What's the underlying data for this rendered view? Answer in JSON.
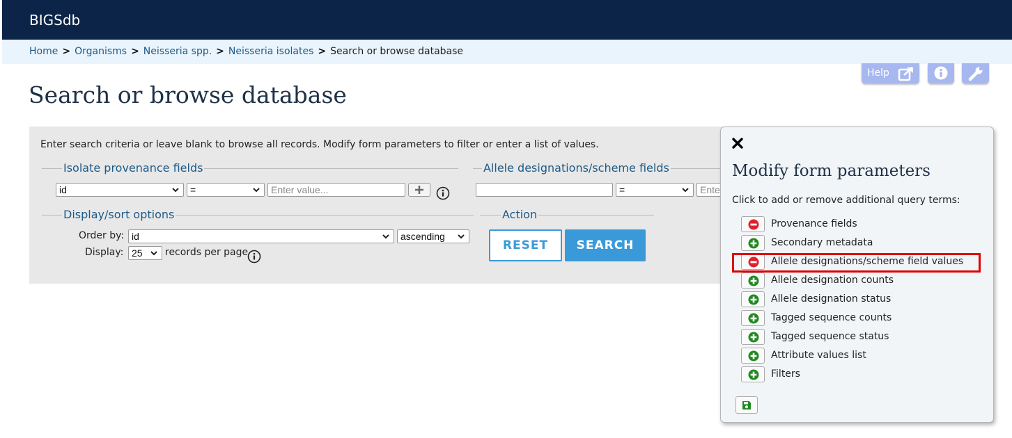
{
  "brand": "BIGSdb",
  "breadcrumb": {
    "items": [
      "Home",
      "Organisms",
      "Neisseria spp.",
      "Neisseria isolates"
    ],
    "current": "Search or browse database",
    "separator": ">"
  },
  "toolbar": {
    "help_label": "Help"
  },
  "page_title": "Search or browse database",
  "search_panel": {
    "instructions": "Enter search criteria or leave blank to browse all records. Modify form parameters to filter or enter a list of values.",
    "provenance": {
      "legend": "Isolate provenance fields",
      "field": "id",
      "operator": "=",
      "value_placeholder": "Enter value..."
    },
    "allele": {
      "legend": "Allele designations/scheme fields",
      "field": "",
      "operator": "=",
      "value_placeholder": "Ente"
    },
    "display_sort": {
      "legend": "Display/sort options",
      "order_by_label": "Order by:",
      "order_by": "id",
      "direction": "ascending",
      "display_label": "Display:",
      "per_page": "25",
      "records_per_page_label": "records per page"
    },
    "action": {
      "legend": "Action",
      "reset_label": "RESET",
      "search_label": "SEARCH"
    }
  },
  "modify_form": {
    "title": "Modify form parameters",
    "instructions": "Click to add or remove additional query terms:",
    "options": [
      {
        "label": "Provenance fields",
        "state": "remove"
      },
      {
        "label": "Secondary metadata",
        "state": "add"
      },
      {
        "label": "Allele designations/scheme field values",
        "state": "remove"
      },
      {
        "label": "Allele designation counts",
        "state": "add"
      },
      {
        "label": "Allele designation status",
        "state": "add"
      },
      {
        "label": "Tagged sequence counts",
        "state": "add"
      },
      {
        "label": "Tagged sequence status",
        "state": "add"
      },
      {
        "label": "Attribute values list",
        "state": "add"
      },
      {
        "label": "Filters",
        "state": "add"
      }
    ]
  },
  "icons": {
    "remove": "minus-circle-icon",
    "add": "plus-circle-icon",
    "save": "save-icon",
    "close": "close-icon"
  },
  "colors": {
    "header_bg": "#0b2447",
    "breadcrumb_bg": "#eaf4fc",
    "link": "#1d5a87",
    "accent": "#3a9ad9",
    "remove": "#e0202a",
    "add": "#1f8a1f",
    "highlight": "#e00000"
  }
}
